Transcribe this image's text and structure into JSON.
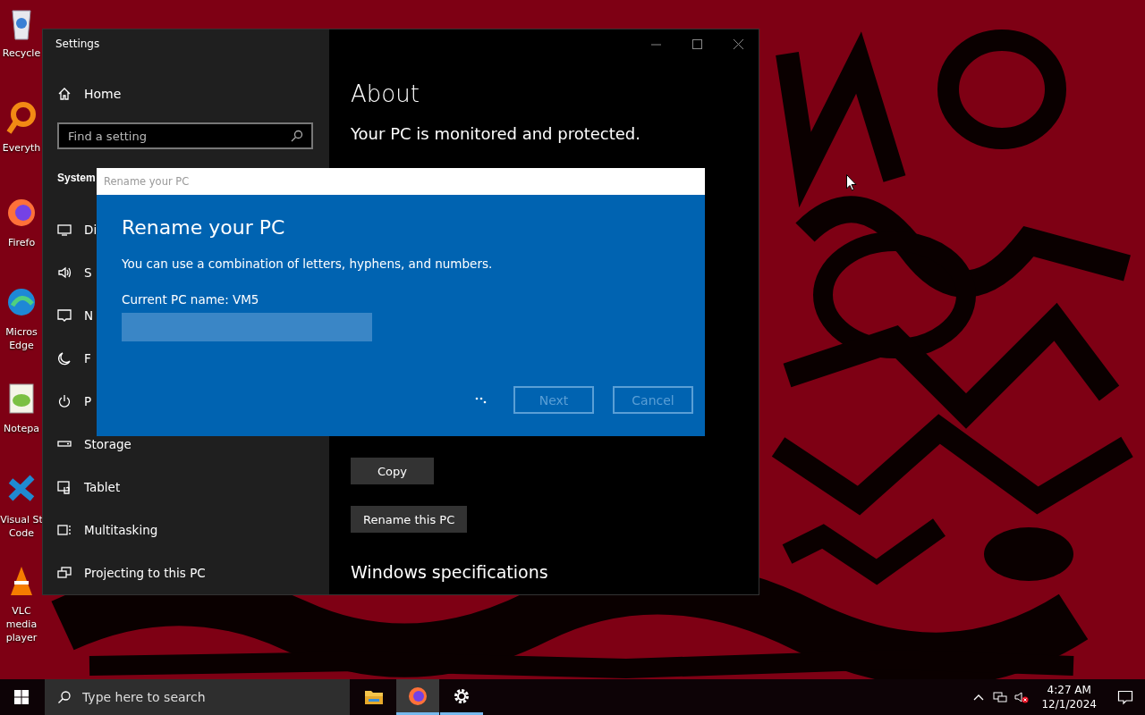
{
  "desktop": {
    "icons": [
      {
        "label": "Recycle"
      },
      {
        "label": "Everyth"
      },
      {
        "label": "Firefo"
      },
      {
        "label": "Micros Edge"
      },
      {
        "label": "Notepa"
      },
      {
        "label": "Visual St Code"
      },
      {
        "label": "VLC media player"
      }
    ]
  },
  "settings_window": {
    "title": "Settings",
    "sidebar": {
      "home": "Home",
      "search": {
        "placeholder": "Find a setting"
      },
      "section": "System",
      "items": [
        {
          "label": "Di"
        },
        {
          "label": "S"
        },
        {
          "label": "N"
        },
        {
          "label": "F"
        },
        {
          "label": "P"
        },
        {
          "label": "Storage"
        },
        {
          "label": "Tablet"
        },
        {
          "label": "Multitasking"
        },
        {
          "label": "Projecting to this PC"
        }
      ]
    },
    "content": {
      "title": "About",
      "status": "Your PC is monitored and protected.",
      "buttons": [
        "Copy",
        "Rename this PC"
      ],
      "section_heading": "Windows specifications"
    }
  },
  "dialog": {
    "title": "Rename your PC",
    "heading": "Rename your PC",
    "description": "You can use a combination of letters, hyphens, and numbers.",
    "current_name": "Current PC name: VM5",
    "busy": true,
    "buttons": [
      {
        "label": "Next",
        "disabled": true
      },
      {
        "label": "Cancel",
        "disabled": true
      }
    ]
  },
  "taskbar": {
    "search": {
      "placeholder": "Type here to search"
    },
    "apps": [
      {
        "active": false,
        "running": false
      },
      {
        "active": true,
        "running": true
      },
      {
        "active": false,
        "running": true
      }
    ],
    "time": "4:27 AM",
    "date": "12/1/2024"
  }
}
